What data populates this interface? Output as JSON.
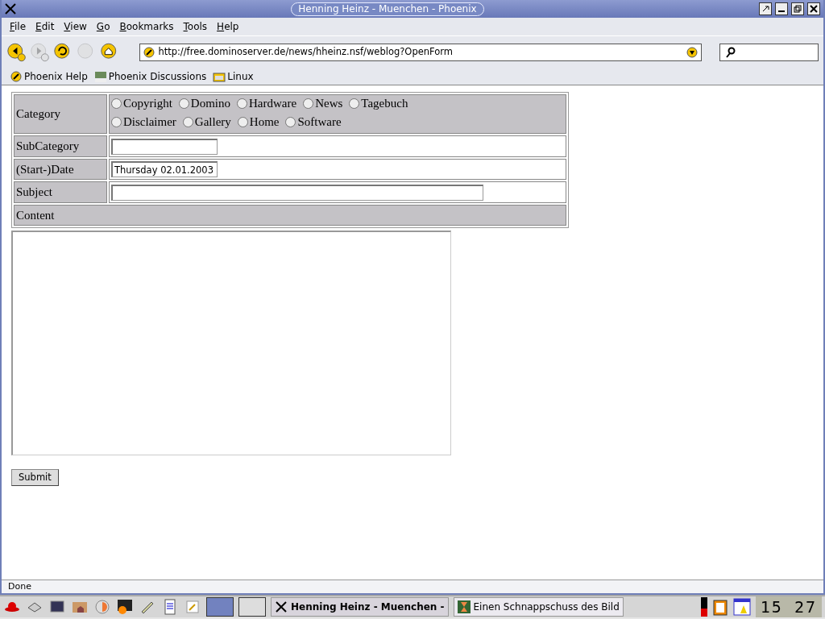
{
  "window": {
    "title": "Henning Heinz - Muenchen - Phoenix"
  },
  "menu": [
    "File",
    "Edit",
    "View",
    "Go",
    "Bookmarks",
    "Tools",
    "Help"
  ],
  "nav_buttons": [
    {
      "kind": "back",
      "disabled": false
    },
    {
      "kind": "forward",
      "disabled": true
    },
    {
      "kind": "reload",
      "disabled": false
    },
    {
      "kind": "stop",
      "disabled": true
    },
    {
      "kind": "home",
      "disabled": false
    }
  ],
  "url": "http://free.dominoserver.de/news/hheinz.nsf/weblog?OpenForm",
  "bookmarks": [
    {
      "kind": "help",
      "label": "Phoenix Help"
    },
    {
      "kind": "zine",
      "label": "Phoenix Discussions"
    },
    {
      "kind": "folder",
      "label": "Linux"
    }
  ],
  "form": {
    "category": {
      "label": "Category",
      "options": [
        [
          {
            "label": "Copyright",
            "selected": false
          },
          {
            "label": "Domino",
            "selected": false
          },
          {
            "label": "Hardware",
            "selected": false
          },
          {
            "label": "News",
            "selected": false
          },
          {
            "label": "Tagebuch",
            "selected": false
          }
        ],
        [
          {
            "label": "Disclaimer",
            "selected": false
          },
          {
            "label": "Gallery",
            "selected": false
          },
          {
            "label": "Home",
            "selected": false
          },
          {
            "label": "Software",
            "selected": false
          }
        ]
      ]
    },
    "fields": [
      {
        "label": "SubCategory"
      },
      {
        "label": "(Start-)Date",
        "value": "Thursday 02.01.2003"
      },
      {
        "label": "Subject"
      }
    ],
    "content_label": "Content",
    "submit": "Submit"
  },
  "status_bar": "Done",
  "taskbar": {
    "desktops": [
      {
        "selected": true
      },
      {
        "selected": false
      }
    ],
    "tasks": [
      {
        "kind": "x",
        "label": "Henning Heinz - Muenchen -",
        "selected": true
      },
      {
        "kind": "snapshot",
        "label": "Einen Schnappschuss des Bild",
        "selected": false
      }
    ],
    "clock": "15 27"
  }
}
